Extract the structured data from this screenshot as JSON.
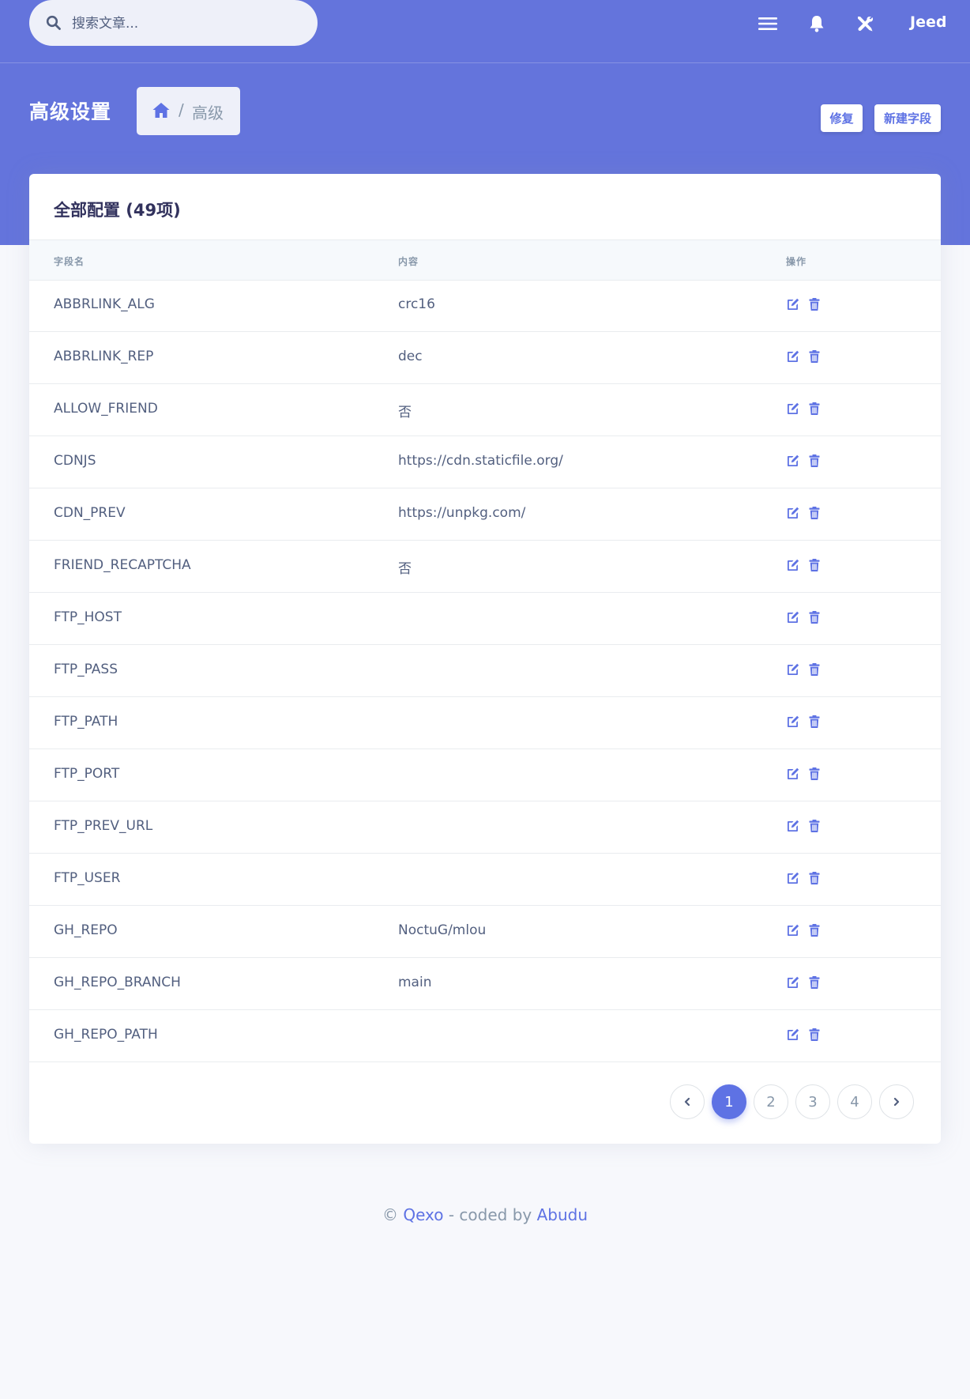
{
  "search": {
    "placeholder": "搜索文章..."
  },
  "topbar": {
    "user": "Jeed"
  },
  "header": {
    "title": "高级设置",
    "breadcrumb": {
      "separator": "/",
      "current": "高级"
    },
    "repair_label": "修复",
    "new_field_label": "新建字段"
  },
  "table": {
    "title": "全部配置 (49项)",
    "columns": [
      "字段名",
      "内容",
      "操作"
    ],
    "rows": [
      {
        "name": "ABBRLINK_ALG",
        "value": "crc16"
      },
      {
        "name": "ABBRLINK_REP",
        "value": "dec"
      },
      {
        "name": "ALLOW_FRIEND",
        "value": "否"
      },
      {
        "name": "CDNJS",
        "value": "https://cdn.staticfile.org/"
      },
      {
        "name": "CDN_PREV",
        "value": "https://unpkg.com/"
      },
      {
        "name": "FRIEND_RECAPTCHA",
        "value": "否"
      },
      {
        "name": "FTP_HOST",
        "value": ""
      },
      {
        "name": "FTP_PASS",
        "value": ""
      },
      {
        "name": "FTP_PATH",
        "value": ""
      },
      {
        "name": "FTP_PORT",
        "value": ""
      },
      {
        "name": "FTP_PREV_URL",
        "value": ""
      },
      {
        "name": "FTP_USER",
        "value": ""
      },
      {
        "name": "GH_REPO",
        "value": "NoctuG/mlou"
      },
      {
        "name": "GH_REPO_BRANCH",
        "value": "main"
      },
      {
        "name": "GH_REPO_PATH",
        "value": ""
      }
    ]
  },
  "pagination": {
    "pages": [
      "1",
      "2",
      "3",
      "4"
    ],
    "current": "1"
  },
  "footer": {
    "copyright": "©",
    "brand": "Qexo",
    "middle": "- coded by",
    "author": "Abudu"
  },
  "colors": {
    "primary": "#5e72e4",
    "header_bg": "#6474dc",
    "page_bg": "#f7f8fc"
  }
}
